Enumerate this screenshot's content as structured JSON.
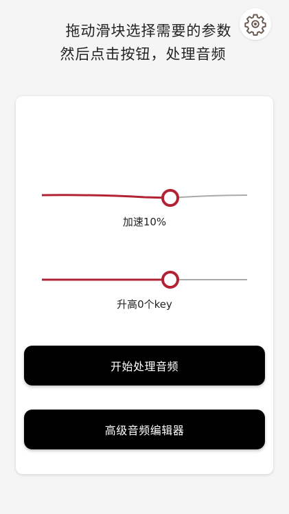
{
  "header": {
    "line1": "拖动滑块选择需要的参数",
    "line2": "然后点击按钮，处理音频"
  },
  "settings": {
    "icon": "gear-icon"
  },
  "sliders": {
    "speed": {
      "label": "加速10%",
      "value_fraction": 0.5
    },
    "pitch": {
      "label": "升高0个key",
      "value_fraction": 0.5
    }
  },
  "buttons": {
    "process": "开始处理音频",
    "editor": "高级音频编辑器"
  },
  "colors": {
    "accent": "#b22234",
    "track_inactive": "#aaaaaa",
    "button_bg": "#000000",
    "background": "#f5f5f5"
  }
}
